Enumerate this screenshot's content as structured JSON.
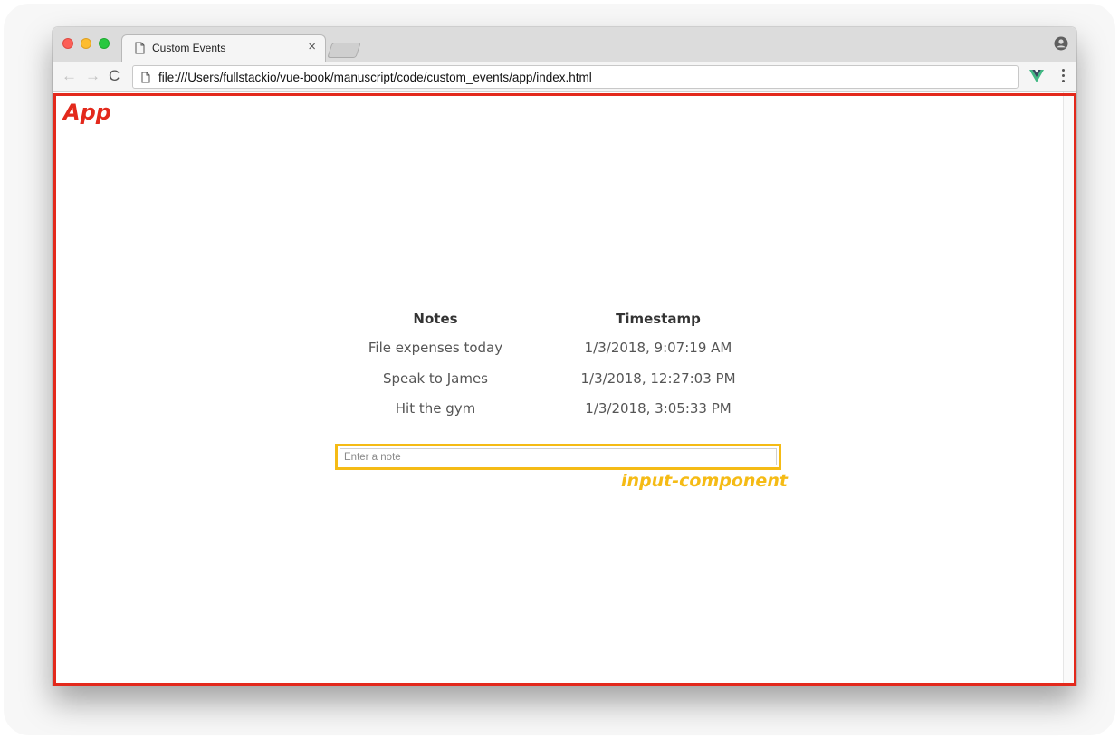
{
  "browser": {
    "tab_title": "Custom Events",
    "tab_close": "×",
    "url": "file:///Users/fullstackio/vue-book/manuscript/code/custom_events/app/index.html",
    "nav": {
      "back": "←",
      "forward": "→",
      "reload": "C"
    }
  },
  "annotations": {
    "app_label": "App",
    "input_component_label": "input-component",
    "app_color": "#e3291c",
    "input_color": "#f5bb15"
  },
  "notes_table": {
    "headers": {
      "notes": "Notes",
      "timestamp": "Timestamp"
    },
    "rows": [
      {
        "note": "File expenses today",
        "timestamp": "1/3/2018, 9:07:19 AM"
      },
      {
        "note": "Speak to James",
        "timestamp": "1/3/2018, 12:27:03 PM"
      },
      {
        "note": "Hit the gym",
        "timestamp": "1/3/2018, 3:05:33 PM"
      }
    ]
  },
  "note_input": {
    "placeholder": "Enter a note",
    "value": ""
  },
  "icons": {
    "tab_favicon": "page-icon",
    "profile": "profile-icon",
    "extension": "vue-devtools-icon",
    "menu": "more-vertical-icon"
  }
}
